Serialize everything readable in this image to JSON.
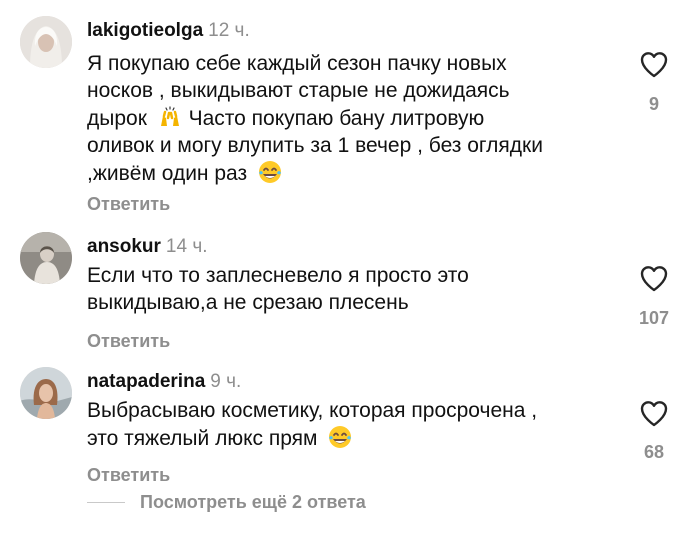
{
  "comments": [
    {
      "username": "lakigotieolga",
      "time": "12 ч.",
      "text_before_raise": "Я покупаю себе каждый сезон пачку новых\nносков , выкидывают старые не дожидаясь\nдырок ",
      "text_after_raise": " Часто покупаю бану литровую\nоливок и могу влупить за 1 вечер , без оглядки\n,живём один раз ",
      "reply_label": "Ответить",
      "likes": "9"
    },
    {
      "username": "ansokur",
      "time": "14 ч.",
      "text": "Если что то заплесневело я просто это\nвыкидываю,а не срезаю плесень",
      "reply_label": "Ответить",
      "likes": "107"
    },
    {
      "username": "natapaderina",
      "time": "9 ч.",
      "text": "Выбрасываю косметику, которая просрочена ,\nэто тяжелый люкс прям ",
      "reply_label": "Ответить",
      "likes": "68"
    }
  ],
  "view_more_replies": "Посмотреть ещё 2 ответа",
  "icons": {
    "like": "heart-outline-icon",
    "raised_hands": "raised-hands-emoji-icon",
    "laugh": "tears-of-joy-emoji-icon"
  },
  "colors": {
    "text": "#111111",
    "secondary": "#8e8e8e",
    "background": "#ffffff"
  }
}
